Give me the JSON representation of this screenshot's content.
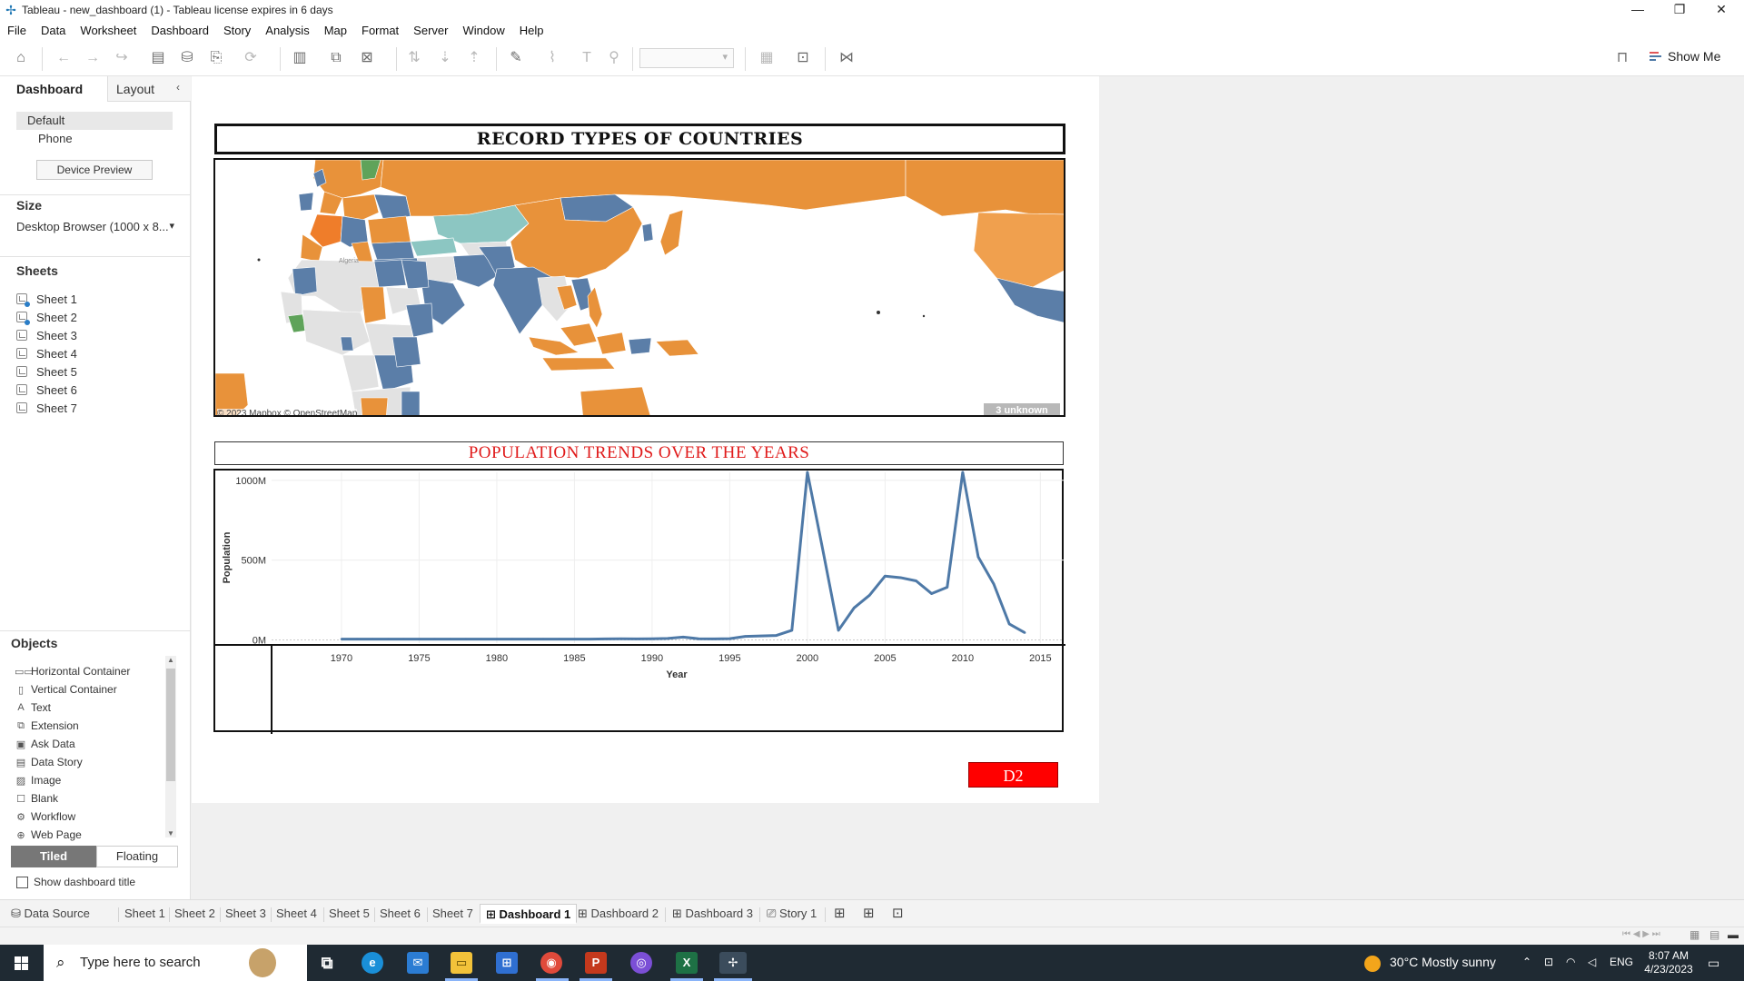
{
  "window": {
    "title": "Tableau - new_dashboard (1) - Tableau license expires in 6 days",
    "minimize": "—",
    "restore": "❐",
    "close": "✕"
  },
  "menu": [
    "File",
    "Data",
    "Worksheet",
    "Dashboard",
    "Story",
    "Analysis",
    "Map",
    "Format",
    "Server",
    "Window",
    "Help"
  ],
  "toolbar": {
    "show_me_label": "Show Me"
  },
  "left_panel": {
    "tab_dashboard": "Dashboard",
    "tab_layout": "Layout",
    "devices": [
      "Default",
      "Phone"
    ],
    "device_preview_button": "Device Preview",
    "size_header": "Size",
    "size_value": "Desktop Browser (1000 x 8...",
    "sheets_header": "Sheets",
    "sheets": [
      {
        "label": "Sheet 1",
        "used": true
      },
      {
        "label": "Sheet 2",
        "used": true
      },
      {
        "label": "Sheet 3",
        "used": false
      },
      {
        "label": "Sheet 4",
        "used": false
      },
      {
        "label": "Sheet 5",
        "used": false
      },
      {
        "label": "Sheet 6",
        "used": false
      },
      {
        "label": "Sheet 7",
        "used": false
      }
    ],
    "objects_header": "Objects",
    "objects": [
      {
        "label": "Horizontal Container",
        "icon": "horizontal-container-icon",
        "glyph": "▭▭"
      },
      {
        "label": "Vertical Container",
        "icon": "vertical-container-icon",
        "glyph": "▯"
      },
      {
        "label": "Text",
        "icon": "text-icon",
        "glyph": "A"
      },
      {
        "label": "Extension",
        "icon": "extension-icon",
        "glyph": "⧉"
      },
      {
        "label": "Ask Data",
        "icon": "ask-data-icon",
        "glyph": "▣"
      },
      {
        "label": "Data Story",
        "icon": "data-story-icon",
        "glyph": "▤"
      },
      {
        "label": "Image",
        "icon": "image-icon",
        "glyph": "▨"
      },
      {
        "label": "Blank",
        "icon": "blank-icon",
        "glyph": "☐"
      },
      {
        "label": "Workflow",
        "icon": "workflow-icon",
        "glyph": "⚙"
      },
      {
        "label": "Web Page",
        "icon": "web-page-icon",
        "glyph": "⊕"
      }
    ],
    "tiled_label": "Tiled",
    "floating_label": "Floating",
    "show_title_label": "Show dashboard title"
  },
  "dashboard": {
    "map_title": "RECORD TYPES OF COUNTRIES",
    "map_attribution": "© 2023 Mapbox © OpenStreetMap",
    "map_unknown_badge": "3 unknown",
    "map_labels": [
      "Algeria"
    ],
    "map_colors": {
      "orange": "#e8923a",
      "blue": "#5b7ea8",
      "teal": "#8cc6c2",
      "green": "#5fa35a",
      "gray": "#e2e2e2",
      "light_orange": "#f0a04e"
    },
    "pop_title": "POPULATION TRENDS OVER THE YEARS",
    "d2_button": "D2"
  },
  "chart_data": {
    "type": "line",
    "title": "POPULATION TRENDS OVER THE YEARS",
    "xlabel": "Year",
    "ylabel": "Population",
    "xlim": [
      1965.5,
      2016.5
    ],
    "ylim": [
      -20,
      1050
    ],
    "x_ticks": [
      1970,
      1975,
      1980,
      1985,
      1990,
      1995,
      2000,
      2005,
      2010,
      2015
    ],
    "y_ticks": [
      0,
      500,
      1000
    ],
    "y_tick_labels": [
      "0M",
      "500M",
      "1000M"
    ],
    "grid": true,
    "color": "#4e79a7",
    "series": [
      {
        "x": [
          1970,
          1971,
          1972,
          1973,
          1974,
          1975,
          1976,
          1977,
          1978,
          1979,
          1980,
          1981,
          1982,
          1983,
          1984,
          1985,
          1986,
          1987,
          1988,
          1989,
          1990,
          1991,
          1992,
          1993,
          1994,
          1995,
          1996,
          1997,
          1998,
          1999,
          2000,
          2001,
          2002,
          2003,
          2004,
          2005,
          2006,
          2007,
          2008,
          2009,
          2010,
          2011,
          2012,
          2013,
          2014
        ],
        "y": [
          5,
          5,
          5,
          5,
          5,
          5,
          5,
          5,
          5,
          5,
          5,
          5,
          5,
          5,
          5,
          5,
          5,
          6,
          7,
          6,
          7,
          9,
          18,
          7,
          6,
          8,
          22,
          25,
          28,
          60,
          1050,
          560,
          60,
          200,
          280,
          400,
          390,
          370,
          290,
          330,
          1050,
          520,
          350,
          100,
          45
        ]
      }
    ]
  },
  "bottom_tabs": [
    {
      "label": "Data Source",
      "icon": "database-icon",
      "glyph": "⛁",
      "active": false
    },
    {
      "label": "Sheet 1",
      "active": false
    },
    {
      "label": "Sheet 2",
      "active": false
    },
    {
      "label": "Sheet 3",
      "active": false
    },
    {
      "label": "Sheet 4",
      "active": false
    },
    {
      "label": "Sheet 5",
      "active": false
    },
    {
      "label": "Sheet 6",
      "active": false
    },
    {
      "label": "Sheet 7",
      "active": false
    },
    {
      "label": "Dashboard 1",
      "icon": "dashboard-icon",
      "glyph": "⊞",
      "active": true
    },
    {
      "label": "Dashboard 2",
      "icon": "dashboard-icon",
      "glyph": "⊞",
      "active": false
    },
    {
      "label": "Dashboard 3",
      "icon": "dashboard-icon",
      "glyph": "⊞",
      "active": false
    },
    {
      "label": "Story 1",
      "icon": "story-icon",
      "glyph": "⎚",
      "active": false
    }
  ],
  "taskbar": {
    "search_placeholder": "Type here to search",
    "weather": "30°C  Mostly sunny",
    "lang": "ENG",
    "time": "8:07 AM",
    "date": "4/23/2023"
  }
}
